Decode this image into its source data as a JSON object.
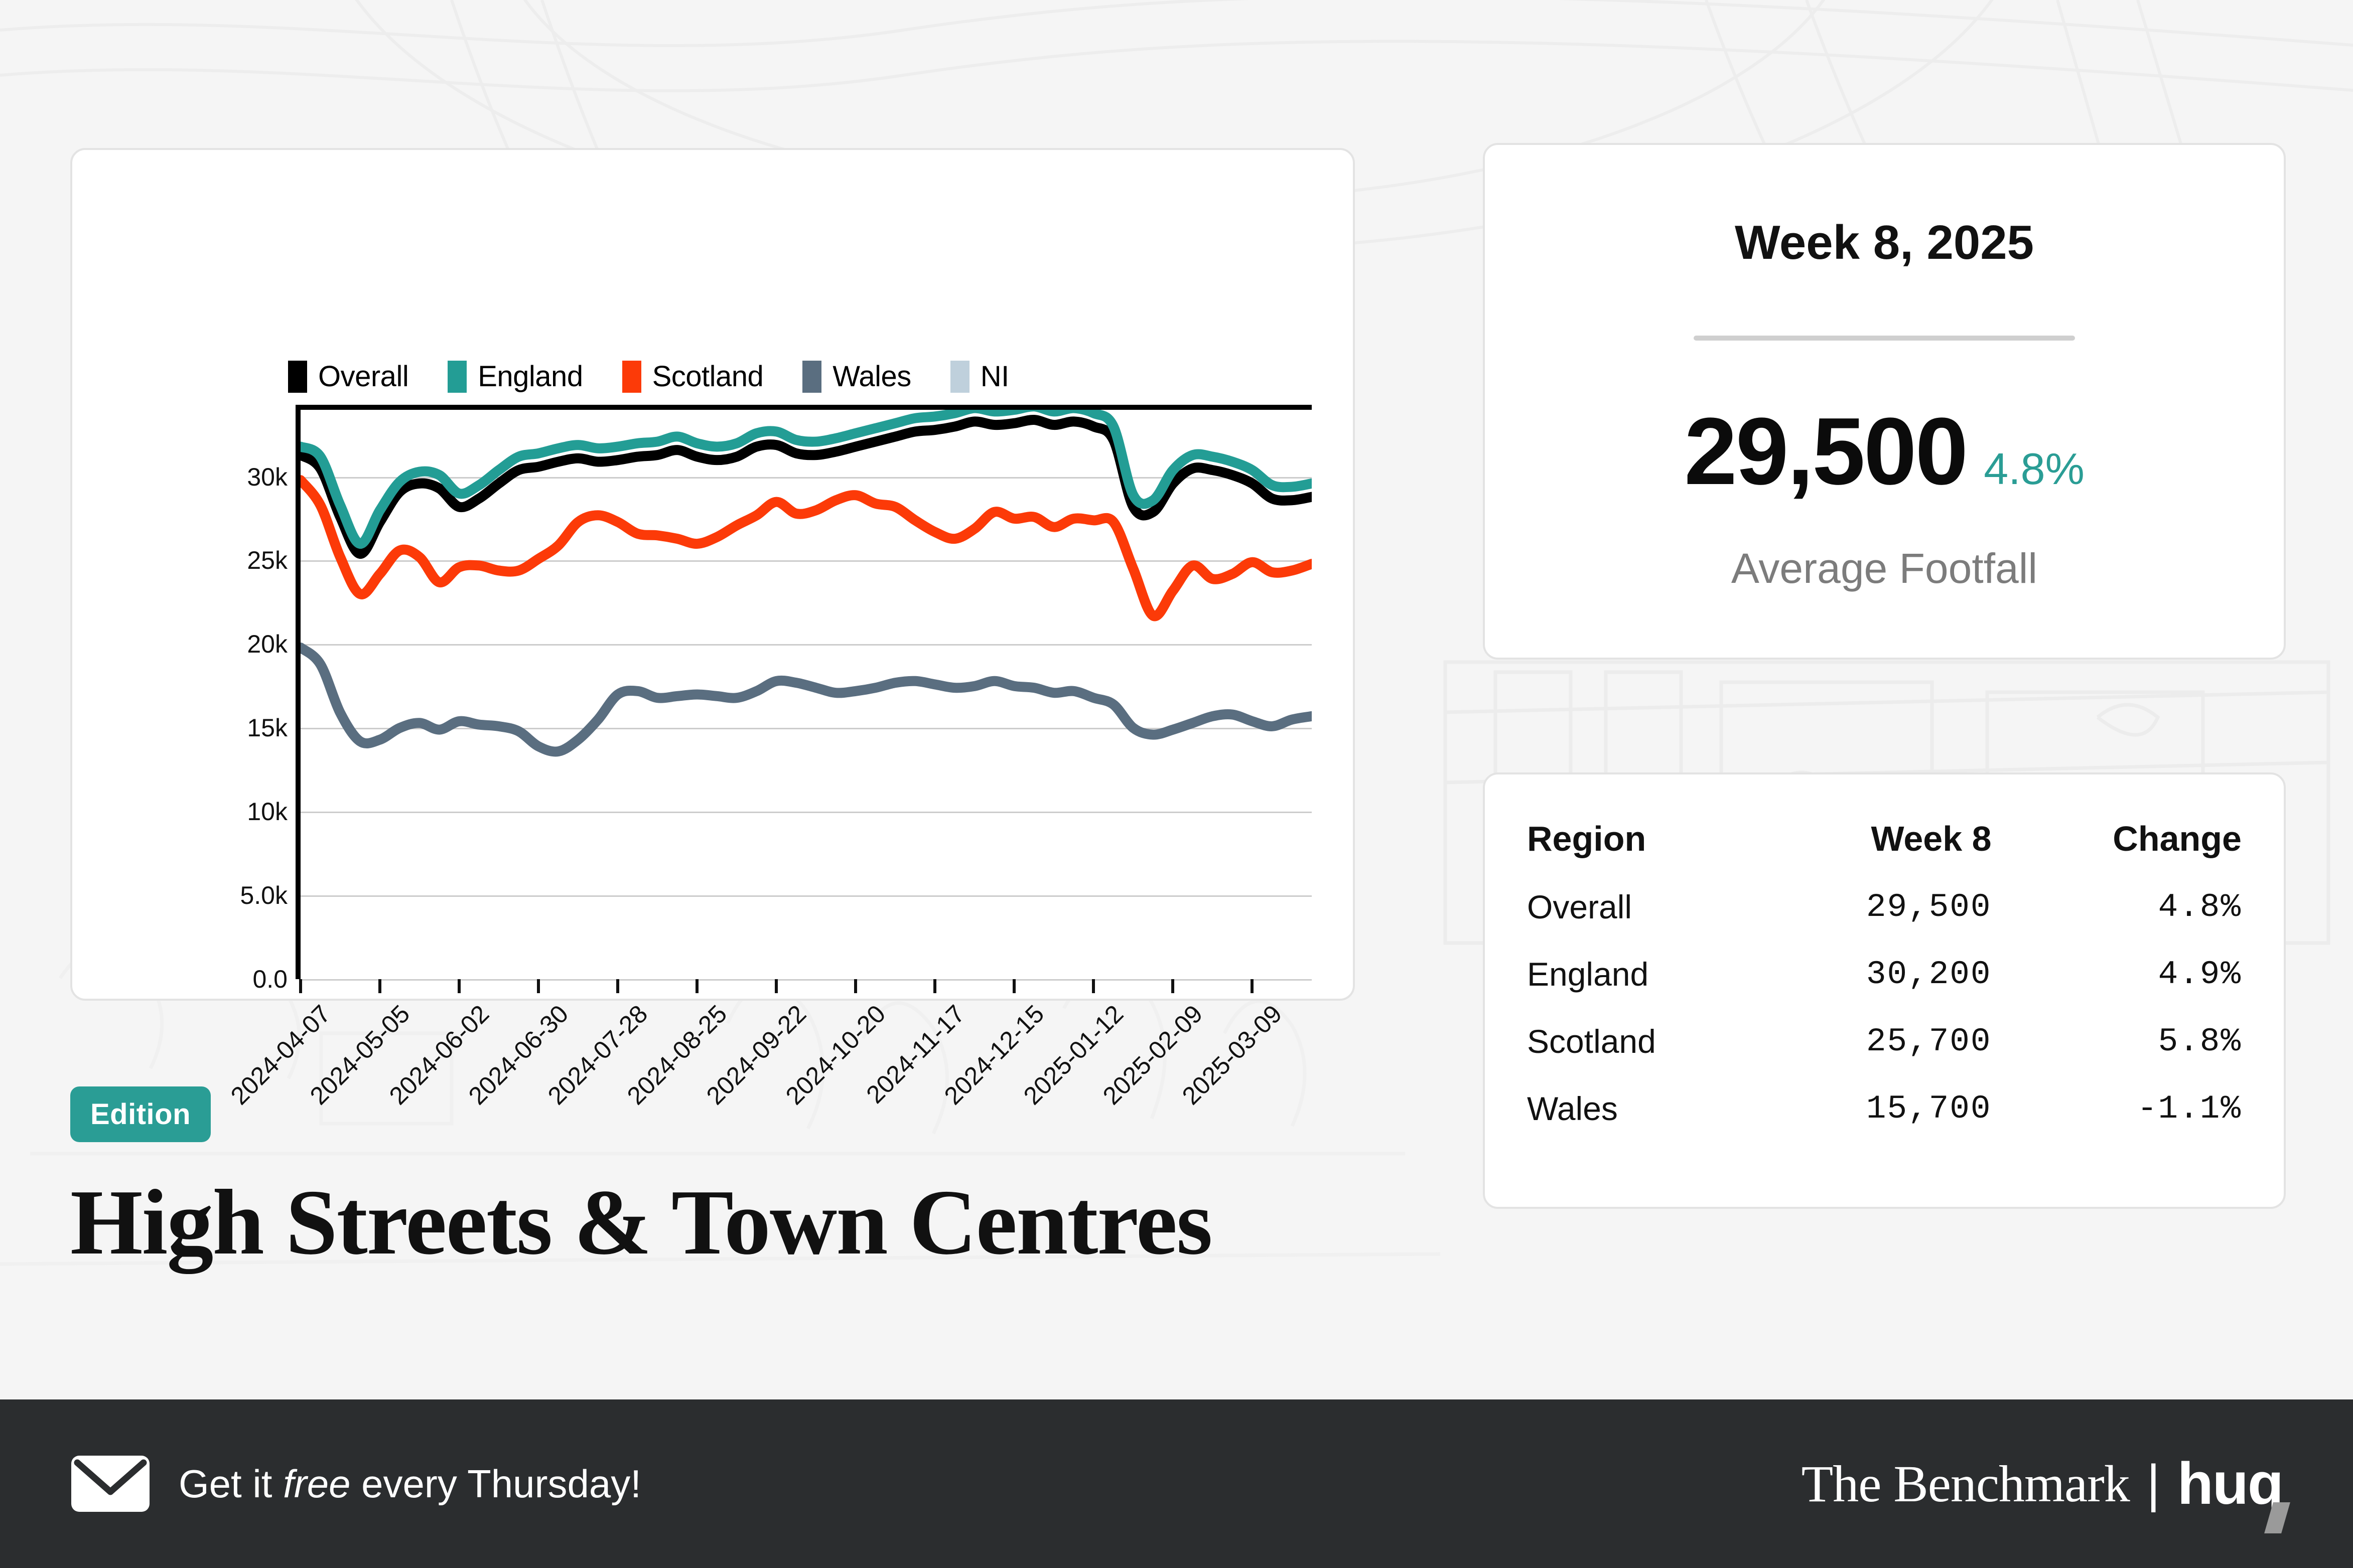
{
  "brand": {
    "accent_teal": "#2a9d95",
    "footer_bg": "#2b2d2f",
    "benchmark_label": "The Benchmark",
    "separator": "|",
    "huq_label": "huq"
  },
  "edition": {
    "badge_label": "Edition"
  },
  "title": {
    "text": "High Streets & Town Centres"
  },
  "kpi": {
    "period": "Week 8, 2025",
    "value": "29,500",
    "delta": "4.8%",
    "caption": "Average Footfall"
  },
  "table": {
    "headers": [
      "Region",
      "Week 8",
      "Change"
    ],
    "rows": [
      {
        "region": "Overall",
        "week8": "29,500",
        "change": "4.8%"
      },
      {
        "region": "England",
        "week8": "30,200",
        "change": "4.9%"
      },
      {
        "region": "Scotland",
        "week8": "25,700",
        "change": "5.8%"
      },
      {
        "region": "Wales",
        "week8": "15,700",
        "change": "-1.1%"
      }
    ]
  },
  "footer": {
    "cta_pre": "Get it ",
    "cta_em": "free",
    "cta_post": " every Thursday!",
    "envelope_icon": "envelope-icon"
  },
  "chart_data": {
    "type": "line",
    "title": "",
    "xlabel": "",
    "ylabel": "",
    "ylim": [
      0,
      34000
    ],
    "grid": true,
    "legend_position": "top-left",
    "y_ticks": [
      {
        "value": 0,
        "label": "0.0"
      },
      {
        "value": 5000,
        "label": "5.0k"
      },
      {
        "value": 10000,
        "label": "10k"
      },
      {
        "value": 15000,
        "label": "15k"
      },
      {
        "value": 20000,
        "label": "20k"
      },
      {
        "value": 25000,
        "label": "25k"
      },
      {
        "value": 30000,
        "label": "30k"
      }
    ],
    "x_tick_labels": [
      "2024-04-07",
      "2024-05-05",
      "2024-06-02",
      "2024-06-30",
      "2024-07-28",
      "2024-08-25",
      "2024-09-22",
      "2024-10-20",
      "2024-11-17",
      "2024-12-15",
      "2025-01-12",
      "2025-02-09",
      "2025-03-09"
    ],
    "legend": [
      {
        "name": "Overall",
        "color": "#000000"
      },
      {
        "name": "England",
        "color": "#239d95"
      },
      {
        "name": "Scotland",
        "color": "#fc3a08"
      },
      {
        "name": "Wales",
        "color": "#5a6e80"
      },
      {
        "name": "NI",
        "color": "#bfd0dc"
      }
    ],
    "series": [
      {
        "name": "Overall",
        "color": "#000000",
        "values": [
          31300,
          30500,
          27600,
          25400,
          27300,
          29100,
          29600,
          29300,
          28200,
          28700,
          29600,
          30400,
          30600,
          30900,
          31100,
          30900,
          31000,
          31200,
          31300,
          31600,
          31200,
          31000,
          31200,
          31800,
          31900,
          31400,
          31300,
          31500,
          31800,
          32100,
          32400,
          32700,
          32800,
          33000,
          33300,
          33100,
          33200,
          33400,
          33100,
          33300,
          33000,
          32200,
          28200,
          27900,
          29600,
          30500,
          30400,
          30100,
          29600,
          28700,
          28600,
          28800
        ]
      },
      {
        "name": "England",
        "color": "#239d95",
        "values": [
          31800,
          31200,
          28300,
          26000,
          28000,
          29700,
          30300,
          30100,
          29000,
          29500,
          30400,
          31200,
          31400,
          31700,
          31900,
          31700,
          31800,
          32000,
          32100,
          32400,
          32000,
          31800,
          32000,
          32600,
          32700,
          32200,
          32100,
          32300,
          32600,
          32900,
          33200,
          33500,
          33600,
          33800,
          34100,
          33900,
          34000,
          34200,
          33900,
          34100,
          33800,
          33000,
          28900,
          28600,
          30400,
          31300,
          31200,
          30900,
          30400,
          29500,
          29400,
          29600
        ]
      },
      {
        "name": "Scotland",
        "color": "#fc3a08",
        "values": [
          29800,
          28300,
          25200,
          23000,
          24200,
          25600,
          25200,
          23700,
          24600,
          24700,
          24400,
          24400,
          25100,
          25900,
          27300,
          27700,
          27300,
          26600,
          26500,
          26300,
          26000,
          26400,
          27100,
          27700,
          28500,
          27800,
          28000,
          28600,
          28900,
          28400,
          28200,
          27400,
          26700,
          26300,
          26900,
          27900,
          27500,
          27600,
          27000,
          27500,
          27400,
          27300,
          24500,
          21700,
          23200,
          24700,
          23900,
          24200,
          24900,
          24300,
          24400,
          24800
        ]
      },
      {
        "name": "Wales",
        "color": "#5a6e80",
        "values": [
          19800,
          18800,
          15900,
          14200,
          14300,
          15000,
          15300,
          14900,
          15400,
          15200,
          15100,
          14800,
          13900,
          13600,
          14300,
          15500,
          17000,
          17200,
          16800,
          16900,
          17000,
          16900,
          16800,
          17200,
          17800,
          17700,
          17400,
          17100,
          17200,
          17400,
          17700,
          17800,
          17600,
          17400,
          17500,
          17800,
          17500,
          17400,
          17100,
          17200,
          16800,
          16400,
          15000,
          14600,
          14900,
          15300,
          15700,
          15800,
          15400,
          15100,
          15500,
          15700
        ]
      }
    ]
  }
}
